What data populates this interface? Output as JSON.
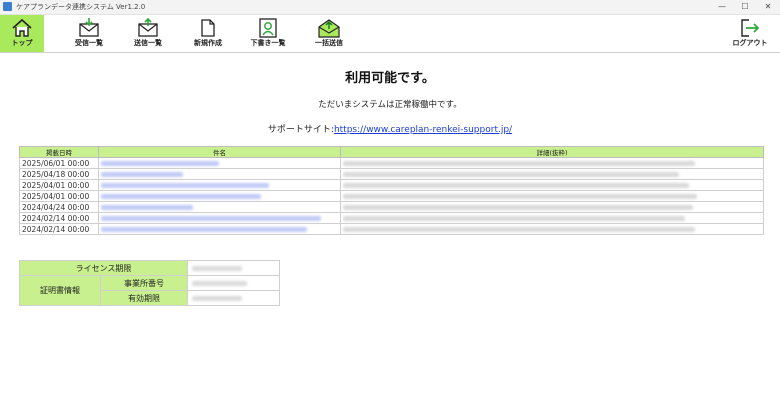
{
  "window": {
    "title": "ケアプランデータ連携システム Ver1.2.0",
    "minimize_glyph": "—",
    "maximize_glyph": "☐",
    "close_glyph": "✕"
  },
  "toolbar": {
    "items": [
      {
        "label": "トップ",
        "icon": "home-icon",
        "active": true
      },
      {
        "label": "受信一覧",
        "icon": "inbox-icon"
      },
      {
        "label": "送信一覧",
        "icon": "outbox-icon"
      },
      {
        "label": "新規作成",
        "icon": "new-document-icon"
      },
      {
        "label": "下書き一覧",
        "icon": "drafts-icon"
      },
      {
        "label": "一括送信",
        "icon": "bulk-send-icon"
      }
    ],
    "logout_label": "ログアウト",
    "logout_icon": "logout-icon"
  },
  "status": {
    "title": "利用可能です。",
    "message": "ただいまシステムは正常稼働中です。",
    "support_label": "サポートサイト:",
    "support_url": "https://www.careplan-renkei-support.jp/"
  },
  "notices": {
    "headers": [
      "掲載日時",
      "件名",
      "詳細(抜粋)"
    ],
    "rows": [
      {
        "date": "2025/06/01 00:00"
      },
      {
        "date": "2025/04/18 00:00"
      },
      {
        "date": "2025/04/01 00:00"
      },
      {
        "date": "2025/04/01 00:00"
      },
      {
        "date": "2024/04/24 00:00"
      },
      {
        "date": "2024/02/14 00:00"
      },
      {
        "date": "2024/02/14 00:00"
      }
    ]
  },
  "license": {
    "period_label": "ライセンス期限",
    "certificate_label": "証明書情報",
    "office_number_label": "事業所番号",
    "validity_label": "有効期限"
  },
  "colors": {
    "accent_green": "#a9ea5c",
    "header_green": "#c8f08e",
    "link_blue": "#1a3fd6"
  }
}
